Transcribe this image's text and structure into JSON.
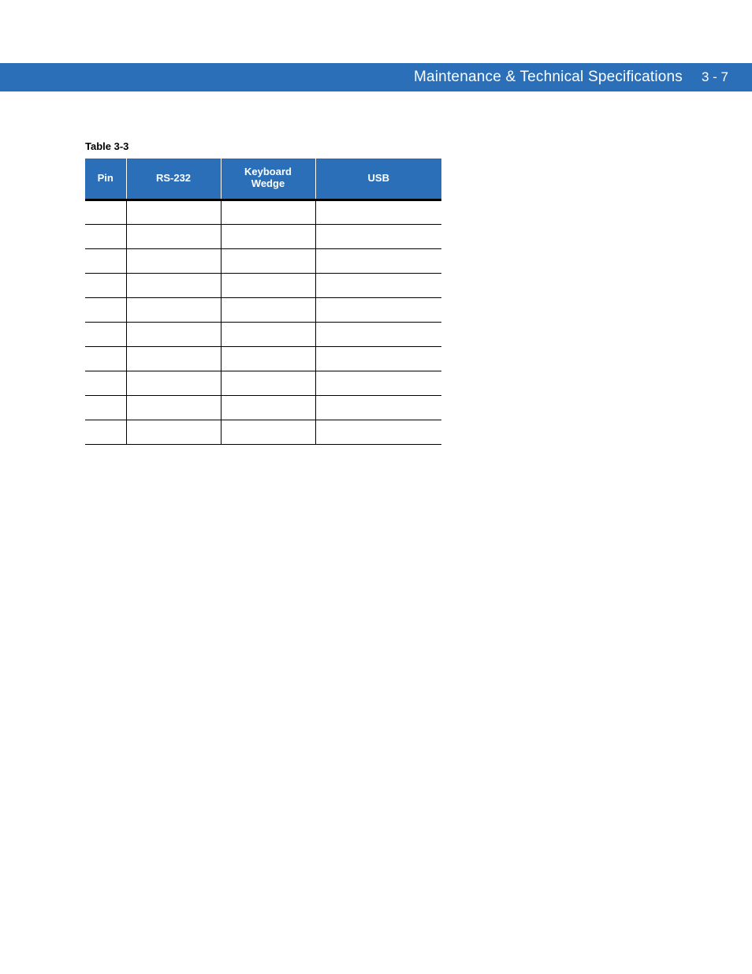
{
  "header": {
    "title": "Maintenance & Technical Specifications",
    "page_number": "3 - 7"
  },
  "table": {
    "caption": "Table 3-3",
    "columns": {
      "pin": "Pin",
      "rs232": "RS-232",
      "keyboard_wedge_line1": "Keyboard",
      "keyboard_wedge_line2": "Wedge",
      "usb": "USB"
    },
    "rows": [
      {
        "pin": "",
        "rs232": "",
        "kw": "",
        "usb": ""
      },
      {
        "pin": "",
        "rs232": "",
        "kw": "",
        "usb": ""
      },
      {
        "pin": "",
        "rs232": "",
        "kw": "",
        "usb": ""
      },
      {
        "pin": "",
        "rs232": "",
        "kw": "",
        "usb": ""
      },
      {
        "pin": "",
        "rs232": "",
        "kw": "",
        "usb": ""
      },
      {
        "pin": "",
        "rs232": "",
        "kw": "",
        "usb": ""
      },
      {
        "pin": "",
        "rs232": "",
        "kw": "",
        "usb": ""
      },
      {
        "pin": "",
        "rs232": "",
        "kw": "",
        "usb": ""
      },
      {
        "pin": "",
        "rs232": "",
        "kw": "",
        "usb": ""
      },
      {
        "pin": "",
        "rs232": "",
        "kw": "",
        "usb": ""
      }
    ]
  }
}
